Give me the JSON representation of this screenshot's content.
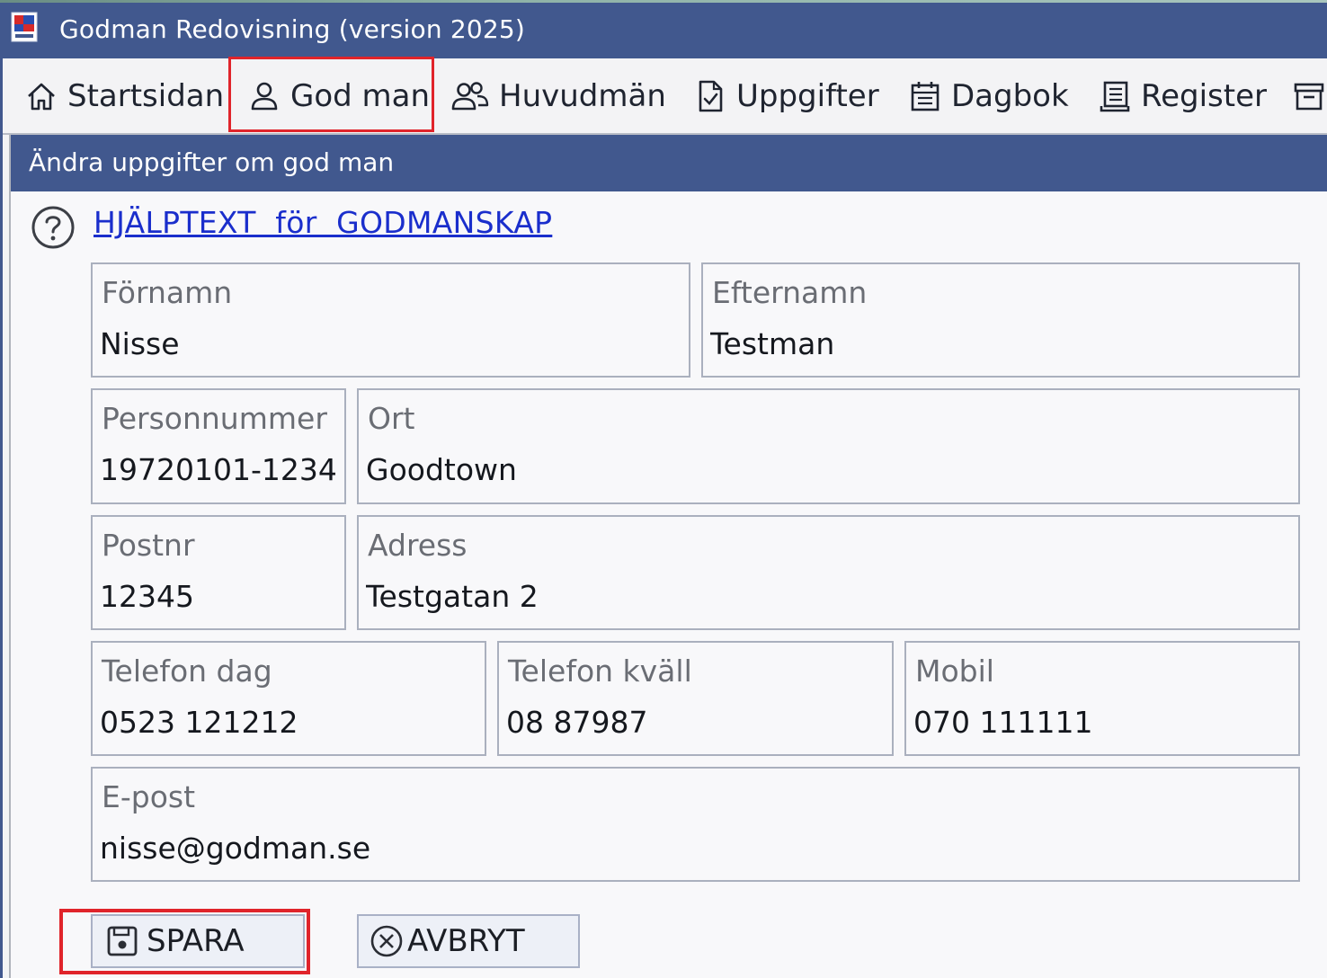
{
  "window": {
    "title": "Godman Redovisning (version 2025)"
  },
  "nav": {
    "items": [
      {
        "label": "Startsidan",
        "icon": "home-icon"
      },
      {
        "label": "God man",
        "icon": "person-icon"
      },
      {
        "label": "Huvudmän",
        "icon": "people-icon"
      },
      {
        "label": "Uppgifter",
        "icon": "document-check-icon"
      },
      {
        "label": "Dagbok",
        "icon": "calendar-icon"
      },
      {
        "label": "Register",
        "icon": "list-icon"
      },
      {
        "label": "",
        "icon": "archive-icon"
      }
    ],
    "active": "God man"
  },
  "panel": {
    "title": "Ändra uppgifter om god man",
    "help_link": "HJÄLPTEXT  för  GODMANSKAP"
  },
  "form": {
    "fornamn": {
      "label": "Förnamn",
      "value": "Nisse"
    },
    "efternamn": {
      "label": "Efternamn",
      "value": "Testman"
    },
    "personnummer": {
      "label": "Personnummer",
      "value": "19720101-1234"
    },
    "ort": {
      "label": "Ort",
      "value": "Goodtown"
    },
    "postnr": {
      "label": "Postnr",
      "value": "12345"
    },
    "adress": {
      "label": "Adress",
      "value": "Testgatan 2"
    },
    "telefon_dag": {
      "label": "Telefon dag",
      "value": "0523 121212"
    },
    "telefon_kvall": {
      "label": "Telefon kväll",
      "value": "08 87987"
    },
    "mobil": {
      "label": "Mobil",
      "value": "070 111111"
    },
    "epost": {
      "label": "E-post",
      "value": "nisse@godman.se"
    }
  },
  "buttons": {
    "save": "SPARA",
    "cancel": "AVBRYT"
  },
  "colors": {
    "header_bg": "#41588e",
    "highlight": "#e0242b",
    "link": "#1a2ecc"
  }
}
